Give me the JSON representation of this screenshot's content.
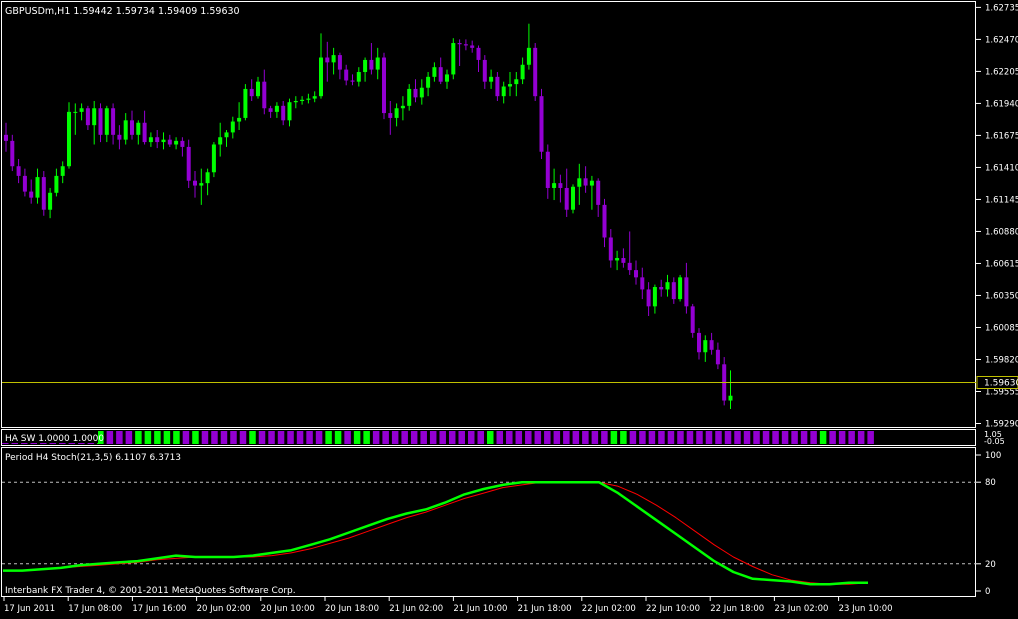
{
  "chart_data": [
    {
      "type": "candlestick",
      "title": "GBPUSDm,H1  1.59442 1.59734 1.59409 1.59630",
      "ylim": [
        1.5929,
        1.6273
      ],
      "y_ticks": [
        "1.62735",
        "1.62470",
        "1.62205",
        "1.61940",
        "1.61675",
        "1.61410",
        "1.61145",
        "1.60880",
        "1.60615",
        "1.60350",
        "1.60085",
        "1.59820",
        "1.59555",
        "1.59290"
      ],
      "current_price_label": "1.59630",
      "current_price": 1.5963,
      "bull_color": "#00ff00",
      "bear_color": "#9400d3",
      "candles": [
        {
          "o": 1.6168,
          "h": 1.6178,
          "l": 1.6154,
          "c": 1.6163
        },
        {
          "o": 1.6163,
          "h": 1.6168,
          "l": 1.6138,
          "c": 1.6142
        },
        {
          "o": 1.6142,
          "h": 1.6148,
          "l": 1.6128,
          "c": 1.6134
        },
        {
          "o": 1.6134,
          "h": 1.614,
          "l": 1.6117,
          "c": 1.6121
        },
        {
          "o": 1.6121,
          "h": 1.6131,
          "l": 1.6111,
          "c": 1.6116
        },
        {
          "o": 1.6116,
          "h": 1.614,
          "l": 1.6111,
          "c": 1.6133
        },
        {
          "o": 1.6133,
          "h": 1.6138,
          "l": 1.6101,
          "c": 1.6106
        },
        {
          "o": 1.6106,
          "h": 1.6124,
          "l": 1.6099,
          "c": 1.612
        },
        {
          "o": 1.612,
          "h": 1.614,
          "l": 1.6117,
          "c": 1.6134
        },
        {
          "o": 1.6134,
          "h": 1.6146,
          "l": 1.6128,
          "c": 1.6142
        },
        {
          "o": 1.6142,
          "h": 1.6195,
          "l": 1.614,
          "c": 1.6187
        },
        {
          "o": 1.6187,
          "h": 1.6194,
          "l": 1.6168,
          "c": 1.6187
        },
        {
          "o": 1.6187,
          "h": 1.6194,
          "l": 1.618,
          "c": 1.619
        },
        {
          "o": 1.619,
          "h": 1.6192,
          "l": 1.6172,
          "c": 1.6176
        },
        {
          "o": 1.6176,
          "h": 1.6196,
          "l": 1.616,
          "c": 1.619
        },
        {
          "o": 1.619,
          "h": 1.6194,
          "l": 1.6162,
          "c": 1.6168
        },
        {
          "o": 1.6168,
          "h": 1.6192,
          "l": 1.6162,
          "c": 1.619
        },
        {
          "o": 1.619,
          "h": 1.6194,
          "l": 1.616,
          "c": 1.6168
        },
        {
          "o": 1.6168,
          "h": 1.6176,
          "l": 1.6156,
          "c": 1.6164
        },
        {
          "o": 1.6164,
          "h": 1.6186,
          "l": 1.616,
          "c": 1.618
        },
        {
          "o": 1.618,
          "h": 1.6188,
          "l": 1.6164,
          "c": 1.6168
        },
        {
          "o": 1.6168,
          "h": 1.618,
          "l": 1.616,
          "c": 1.6178
        },
        {
          "o": 1.6178,
          "h": 1.6188,
          "l": 1.616,
          "c": 1.6162
        },
        {
          "o": 1.6162,
          "h": 1.617,
          "l": 1.6158,
          "c": 1.6166
        },
        {
          "o": 1.6166,
          "h": 1.6172,
          "l": 1.6157,
          "c": 1.6162
        },
        {
          "o": 1.6162,
          "h": 1.617,
          "l": 1.6156,
          "c": 1.6164
        },
        {
          "o": 1.6164,
          "h": 1.6168,
          "l": 1.6158,
          "c": 1.616
        },
        {
          "o": 1.616,
          "h": 1.6166,
          "l": 1.6156,
          "c": 1.6163
        },
        {
          "o": 1.6163,
          "h": 1.6166,
          "l": 1.615,
          "c": 1.6158
        },
        {
          "o": 1.6158,
          "h": 1.6164,
          "l": 1.6124,
          "c": 1.613
        },
        {
          "o": 1.613,
          "h": 1.6138,
          "l": 1.6116,
          "c": 1.6126
        },
        {
          "o": 1.6126,
          "h": 1.614,
          "l": 1.611,
          "c": 1.6128
        },
        {
          "o": 1.6128,
          "h": 1.614,
          "l": 1.6118,
          "c": 1.6137
        },
        {
          "o": 1.6137,
          "h": 1.6162,
          "l": 1.6133,
          "c": 1.616
        },
        {
          "o": 1.616,
          "h": 1.6178,
          "l": 1.615,
          "c": 1.6166
        },
        {
          "o": 1.6166,
          "h": 1.6172,
          "l": 1.6158,
          "c": 1.617
        },
        {
          "o": 1.617,
          "h": 1.6183,
          "l": 1.6165,
          "c": 1.6179
        },
        {
          "o": 1.6179,
          "h": 1.6195,
          "l": 1.6172,
          "c": 1.6182
        },
        {
          "o": 1.6182,
          "h": 1.621,
          "l": 1.618,
          "c": 1.6206
        },
        {
          "o": 1.6206,
          "h": 1.6214,
          "l": 1.6196,
          "c": 1.62
        },
        {
          "o": 1.62,
          "h": 1.6216,
          "l": 1.6198,
          "c": 1.6212
        },
        {
          "o": 1.6212,
          "h": 1.6222,
          "l": 1.6185,
          "c": 1.619
        },
        {
          "o": 1.619,
          "h": 1.6192,
          "l": 1.6182,
          "c": 1.6187
        },
        {
          "o": 1.6187,
          "h": 1.6195,
          "l": 1.6182,
          "c": 1.6192
        },
        {
          "o": 1.6192,
          "h": 1.6196,
          "l": 1.6176,
          "c": 1.618
        },
        {
          "o": 1.618,
          "h": 1.6198,
          "l": 1.6175,
          "c": 1.6195
        },
        {
          "o": 1.6195,
          "h": 1.62,
          "l": 1.619,
          "c": 1.6196
        },
        {
          "o": 1.6196,
          "h": 1.62,
          "l": 1.6193,
          "c": 1.6197
        },
        {
          "o": 1.6197,
          "h": 1.6202,
          "l": 1.6194,
          "c": 1.6198
        },
        {
          "o": 1.6198,
          "h": 1.6204,
          "l": 1.6195,
          "c": 1.62
        },
        {
          "o": 1.62,
          "h": 1.6252,
          "l": 1.6198,
          "c": 1.6232
        },
        {
          "o": 1.6232,
          "h": 1.6245,
          "l": 1.6212,
          "c": 1.6228
        },
        {
          "o": 1.6228,
          "h": 1.624,
          "l": 1.6218,
          "c": 1.6234
        },
        {
          "o": 1.6234,
          "h": 1.6236,
          "l": 1.6214,
          "c": 1.6222
        },
        {
          "o": 1.6222,
          "h": 1.6226,
          "l": 1.6209,
          "c": 1.6213
        },
        {
          "o": 1.6213,
          "h": 1.6218,
          "l": 1.6209,
          "c": 1.6212
        },
        {
          "o": 1.6212,
          "h": 1.6224,
          "l": 1.6208,
          "c": 1.622
        },
        {
          "o": 1.622,
          "h": 1.6232,
          "l": 1.6212,
          "c": 1.623
        },
        {
          "o": 1.623,
          "h": 1.6244,
          "l": 1.6218,
          "c": 1.6222
        },
        {
          "o": 1.6222,
          "h": 1.624,
          "l": 1.6214,
          "c": 1.6232
        },
        {
          "o": 1.6232,
          "h": 1.6236,
          "l": 1.6181,
          "c": 1.6186
        },
        {
          "o": 1.6186,
          "h": 1.6196,
          "l": 1.6168,
          "c": 1.6182
        },
        {
          "o": 1.6182,
          "h": 1.6194,
          "l": 1.6175,
          "c": 1.619
        },
        {
          "o": 1.619,
          "h": 1.62,
          "l": 1.618,
          "c": 1.6192
        },
        {
          "o": 1.6192,
          "h": 1.621,
          "l": 1.6188,
          "c": 1.6206
        },
        {
          "o": 1.6206,
          "h": 1.6214,
          "l": 1.6195,
          "c": 1.6199
        },
        {
          "o": 1.6199,
          "h": 1.6214,
          "l": 1.6193,
          "c": 1.6207
        },
        {
          "o": 1.6207,
          "h": 1.622,
          "l": 1.62,
          "c": 1.6216
        },
        {
          "o": 1.6216,
          "h": 1.6228,
          "l": 1.6212,
          "c": 1.6224
        },
        {
          "o": 1.6224,
          "h": 1.6232,
          "l": 1.621,
          "c": 1.6212
        },
        {
          "o": 1.6212,
          "h": 1.6222,
          "l": 1.6206,
          "c": 1.6218
        },
        {
          "o": 1.6218,
          "h": 1.6248,
          "l": 1.6214,
          "c": 1.6244
        },
        {
          "o": 1.6244,
          "h": 1.6247,
          "l": 1.6225,
          "c": 1.6243
        },
        {
          "o": 1.6243,
          "h": 1.6247,
          "l": 1.6238,
          "c": 1.6242
        },
        {
          "o": 1.6242,
          "h": 1.6246,
          "l": 1.6236,
          "c": 1.624
        },
        {
          "o": 1.624,
          "h": 1.6242,
          "l": 1.622,
          "c": 1.623
        },
        {
          "o": 1.623,
          "h": 1.6234,
          "l": 1.6206,
          "c": 1.6212
        },
        {
          "o": 1.6212,
          "h": 1.6222,
          "l": 1.6206,
          "c": 1.6216
        },
        {
          "o": 1.6216,
          "h": 1.622,
          "l": 1.6196,
          "c": 1.62
        },
        {
          "o": 1.62,
          "h": 1.6212,
          "l": 1.6194,
          "c": 1.6208
        },
        {
          "o": 1.6208,
          "h": 1.622,
          "l": 1.62,
          "c": 1.621
        },
        {
          "o": 1.621,
          "h": 1.622,
          "l": 1.62,
          "c": 1.6214
        },
        {
          "o": 1.6214,
          "h": 1.6232,
          "l": 1.621,
          "c": 1.6226
        },
        {
          "o": 1.6226,
          "h": 1.626,
          "l": 1.6222,
          "c": 1.624
        },
        {
          "o": 1.624,
          "h": 1.6244,
          "l": 1.6196,
          "c": 1.62
        },
        {
          "o": 1.62,
          "h": 1.6206,
          "l": 1.6148,
          "c": 1.6154
        },
        {
          "o": 1.6154,
          "h": 1.616,
          "l": 1.6115,
          "c": 1.6124
        },
        {
          "o": 1.6124,
          "h": 1.614,
          "l": 1.6114,
          "c": 1.6128
        },
        {
          "o": 1.6128,
          "h": 1.6135,
          "l": 1.6112,
          "c": 1.6124
        },
        {
          "o": 1.6124,
          "h": 1.614,
          "l": 1.61,
          "c": 1.6106
        },
        {
          "o": 1.6106,
          "h": 1.6127,
          "l": 1.6103,
          "c": 1.6125
        },
        {
          "o": 1.6125,
          "h": 1.6144,
          "l": 1.611,
          "c": 1.6132
        },
        {
          "o": 1.6132,
          "h": 1.6142,
          "l": 1.612,
          "c": 1.6126
        },
        {
          "o": 1.6126,
          "h": 1.6134,
          "l": 1.6106,
          "c": 1.613
        },
        {
          "o": 1.613,
          "h": 1.6132,
          "l": 1.61,
          "c": 1.611
        },
        {
          "o": 1.611,
          "h": 1.6115,
          "l": 1.6075,
          "c": 1.6083
        },
        {
          "o": 1.6083,
          "h": 1.609,
          "l": 1.6058,
          "c": 1.6064
        },
        {
          "o": 1.6064,
          "h": 1.6072,
          "l": 1.6056,
          "c": 1.6066
        },
        {
          "o": 1.6066,
          "h": 1.6074,
          "l": 1.6058,
          "c": 1.6062
        },
        {
          "o": 1.6062,
          "h": 1.6088,
          "l": 1.6052,
          "c": 1.6056
        },
        {
          "o": 1.6056,
          "h": 1.6064,
          "l": 1.6044,
          "c": 1.605
        },
        {
          "o": 1.605,
          "h": 1.6058,
          "l": 1.6032,
          "c": 1.604
        },
        {
          "o": 1.604,
          "h": 1.6046,
          "l": 1.6018,
          "c": 1.6026
        },
        {
          "o": 1.6026,
          "h": 1.6044,
          "l": 1.602,
          "c": 1.6042
        },
        {
          "o": 1.6042,
          "h": 1.6048,
          "l": 1.6034,
          "c": 1.604
        },
        {
          "o": 1.604,
          "h": 1.6052,
          "l": 1.6034,
          "c": 1.6046
        },
        {
          "o": 1.6046,
          "h": 1.605,
          "l": 1.6028,
          "c": 1.6032
        },
        {
          "o": 1.6032,
          "h": 1.6052,
          "l": 1.603,
          "c": 1.605
        },
        {
          "o": 1.605,
          "h": 1.6062,
          "l": 1.602,
          "c": 1.6026
        },
        {
          "o": 1.6026,
          "h": 1.6028,
          "l": 1.6,
          "c": 1.6004
        },
        {
          "o": 1.6004,
          "h": 1.6008,
          "l": 1.5982,
          "c": 1.5988
        },
        {
          "o": 1.5988,
          "h": 1.6002,
          "l": 1.598,
          "c": 1.5998
        },
        {
          "o": 1.5998,
          "h": 1.6004,
          "l": 1.5986,
          "c": 1.599
        },
        {
          "o": 1.599,
          "h": 1.5996,
          "l": 1.5974,
          "c": 1.5978
        },
        {
          "o": 1.5978,
          "h": 1.5984,
          "l": 1.5944,
          "c": 1.5948
        },
        {
          "o": 1.5948,
          "h": 1.5973,
          "l": 1.5941,
          "c": 1.5952
        }
      ]
    },
    {
      "type": "bar",
      "label": "HA SW 1.0000 1.0000",
      "axis_labels": [
        "1.05",
        "-0.05"
      ],
      "bull_color": "#00ff00",
      "bear_color": "#9400d3",
      "colors": "PPPPPPPPPPGPPPGGGGGPGPPPPPGPPPPPPPGGPGGPPPPPPPPPPPPGPPPPPPPPPPPPGGPPPPPPPPPPPPPPPPPPPPGPPPPP"
    },
    {
      "type": "line",
      "title": "Period H4 Stoch(21,3,5) 6.1107 6.3713",
      "ylim": [
        0,
        100
      ],
      "y_ticks": [
        "100",
        "80",
        "20",
        "0"
      ],
      "levels": [
        80,
        20
      ],
      "series": [
        {
          "color": "#00ff00",
          "values": [
            15,
            15,
            16,
            17,
            19,
            20,
            21,
            22,
            24,
            26,
            25,
            25,
            25,
            26,
            28,
            30,
            34,
            38,
            43,
            48,
            53,
            57,
            60,
            65,
            71,
            75,
            78,
            80,
            80,
            80,
            80,
            80,
            72,
            62,
            52,
            42,
            32,
            22,
            14,
            9,
            8,
            7,
            5,
            5,
            6,
            6
          ]
        },
        {
          "color": "#ff0000",
          "values": [
            15,
            15,
            16,
            17,
            18,
            19,
            20,
            21,
            23,
            24,
            25,
            25,
            25,
            25,
            26,
            28,
            31,
            35,
            39,
            44,
            49,
            54,
            58,
            63,
            68,
            72,
            76,
            78,
            80,
            80,
            80,
            80,
            77,
            71,
            63,
            54,
            44,
            34,
            25,
            18,
            12,
            8,
            6,
            5,
            5,
            6
          ]
        }
      ]
    }
  ],
  "x_axis_labels": [
    "17 Jun 2011",
    "17 Jun 08:00",
    "17 Jun 16:00",
    "20 Jun 02:00",
    "20 Jun 10:00",
    "20 Jun 18:00",
    "21 Jun 02:00",
    "21 Jun 10:00",
    "21 Jun 18:00",
    "22 Jun 02:00",
    "22 Jun 10:00",
    "22 Jun 18:00",
    "23 Jun 02:00",
    "23 Jun 10:00"
  ],
  "copyright": "Interbank FX Trader 4, © 2001-2011 MetaQuotes Software Corp."
}
